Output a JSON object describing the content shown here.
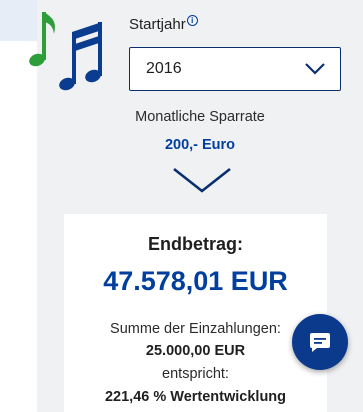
{
  "start_year": {
    "label": "Startjahr",
    "info_glyph": "i",
    "selected": "2016"
  },
  "savings_rate": {
    "label": "Monatliche Sparrate",
    "value": "200,- Euro"
  },
  "result": {
    "title": "Endbetrag:",
    "amount": "47.578,01 EUR",
    "sum_label": "Summe der Einzahlungen:",
    "sum_value": "25.000,00 EUR",
    "equals_label": "entspricht:",
    "growth_value": "221,46 % Wertentwicklung"
  },
  "icons": {
    "music": "music-notes-icon",
    "dropdown": "chevron-down-icon",
    "expand": "chevron-down-icon",
    "chat": "chat-icon",
    "info": "info-icon"
  },
  "colors": {
    "accent_blue": "#003f9e",
    "note_green": "#2e9e3a",
    "note_blue": "#0a3d8f",
    "chat_button": "#0b3a8c"
  }
}
